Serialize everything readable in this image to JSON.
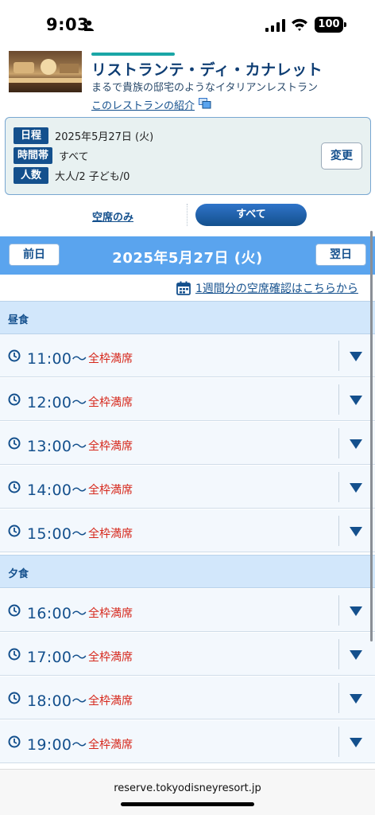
{
  "status_bar": {
    "time": "9:03",
    "battery": "100"
  },
  "restaurant": {
    "name": "リストランテ・ディ・カナレット",
    "description": "まるで貴族の邸宅のようなイタリアンレストラン",
    "intro_link": "このレストランの紹介"
  },
  "info": {
    "date_label": "日程",
    "date_value": "2025年5月27日 (火)",
    "time_label": "時間帯",
    "time_value": "すべて",
    "people_label": "人数",
    "people_value": "大人/2 子ども/0",
    "change_button": "変更"
  },
  "filter": {
    "vacant_only": "空席のみ",
    "all": "すべて"
  },
  "date_nav": {
    "prev": "前日",
    "current": "2025年5月27日 (火)",
    "next": "翌日"
  },
  "week_link": "1週間分の空席確認はこちらから",
  "lunch": {
    "label": "昼食",
    "slots": [
      {
        "time": "11:00～",
        "status": "全枠満席"
      },
      {
        "time": "12:00～",
        "status": "全枠満席"
      },
      {
        "time": "13:00～",
        "status": "全枠満席"
      },
      {
        "time": "14:00～",
        "status": "全枠満席"
      },
      {
        "time": "15:00～",
        "status": "全枠満席"
      }
    ]
  },
  "dinner": {
    "label": "夕食",
    "slots": [
      {
        "time": "16:00～",
        "status": "全枠満席"
      },
      {
        "time": "17:00～",
        "status": "全枠満席"
      },
      {
        "time": "18:00～",
        "status": "全枠満席"
      },
      {
        "time": "19:00～",
        "status": "全枠満席"
      }
    ]
  },
  "browser": {
    "url": "reserve.tokyodisneyresort.jp"
  },
  "colors": {
    "brand_navy": "#14508d",
    "accent_teal": "#1aa6a6",
    "date_bar": "#5aa4ee",
    "full_status": "#d6281c"
  }
}
